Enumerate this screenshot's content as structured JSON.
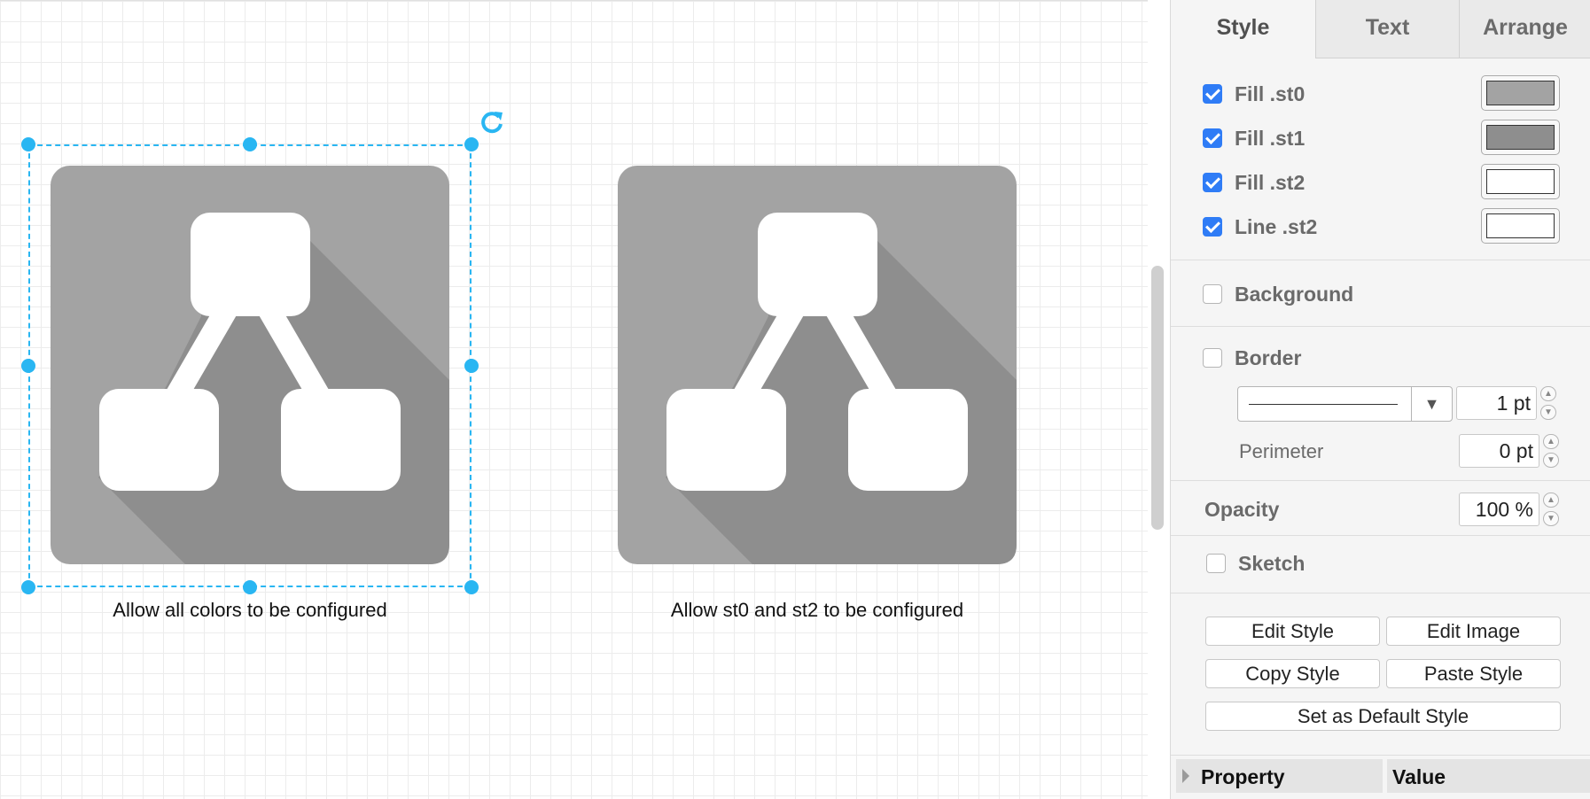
{
  "canvas": {
    "shapes": [
      {
        "caption": "Allow all colors to be configured",
        "selected": true
      },
      {
        "caption": "Allow st0 and st2 to be configured",
        "selected": false
      }
    ],
    "icon_colors": {
      "st0": "#a3a3a3",
      "st1": "#8e8e8e",
      "st2": "#ffffff"
    }
  },
  "panel": {
    "tabs": [
      {
        "label": "Style",
        "active": true
      },
      {
        "label": "Text",
        "active": false
      },
      {
        "label": "Arrange",
        "active": false
      }
    ],
    "fills": [
      {
        "label": "Fill .st0",
        "checked": true,
        "color": "#a3a3a3"
      },
      {
        "label": "Fill .st1",
        "checked": true,
        "color": "#8e8e8e"
      },
      {
        "label": "Fill .st2",
        "checked": true,
        "color": "#ffffff"
      },
      {
        "label": "Line .st2",
        "checked": true,
        "color": "#ffffff"
      }
    ],
    "background": {
      "label": "Background",
      "checked": false
    },
    "border": {
      "label": "Border",
      "checked": false,
      "width": "1 pt",
      "perimeter_label": "Perimeter",
      "perimeter": "0 pt"
    },
    "opacity": {
      "label": "Opacity",
      "value": "100 %"
    },
    "sketch": {
      "label": "Sketch",
      "checked": false
    },
    "buttons": {
      "edit_style": "Edit Style",
      "edit_image": "Edit Image",
      "copy_style": "Copy Style",
      "paste_style": "Paste Style",
      "set_default": "Set as Default Style"
    },
    "properties": {
      "col_property": "Property",
      "col_value": "Value"
    }
  },
  "accent_color": "#29b6f2"
}
